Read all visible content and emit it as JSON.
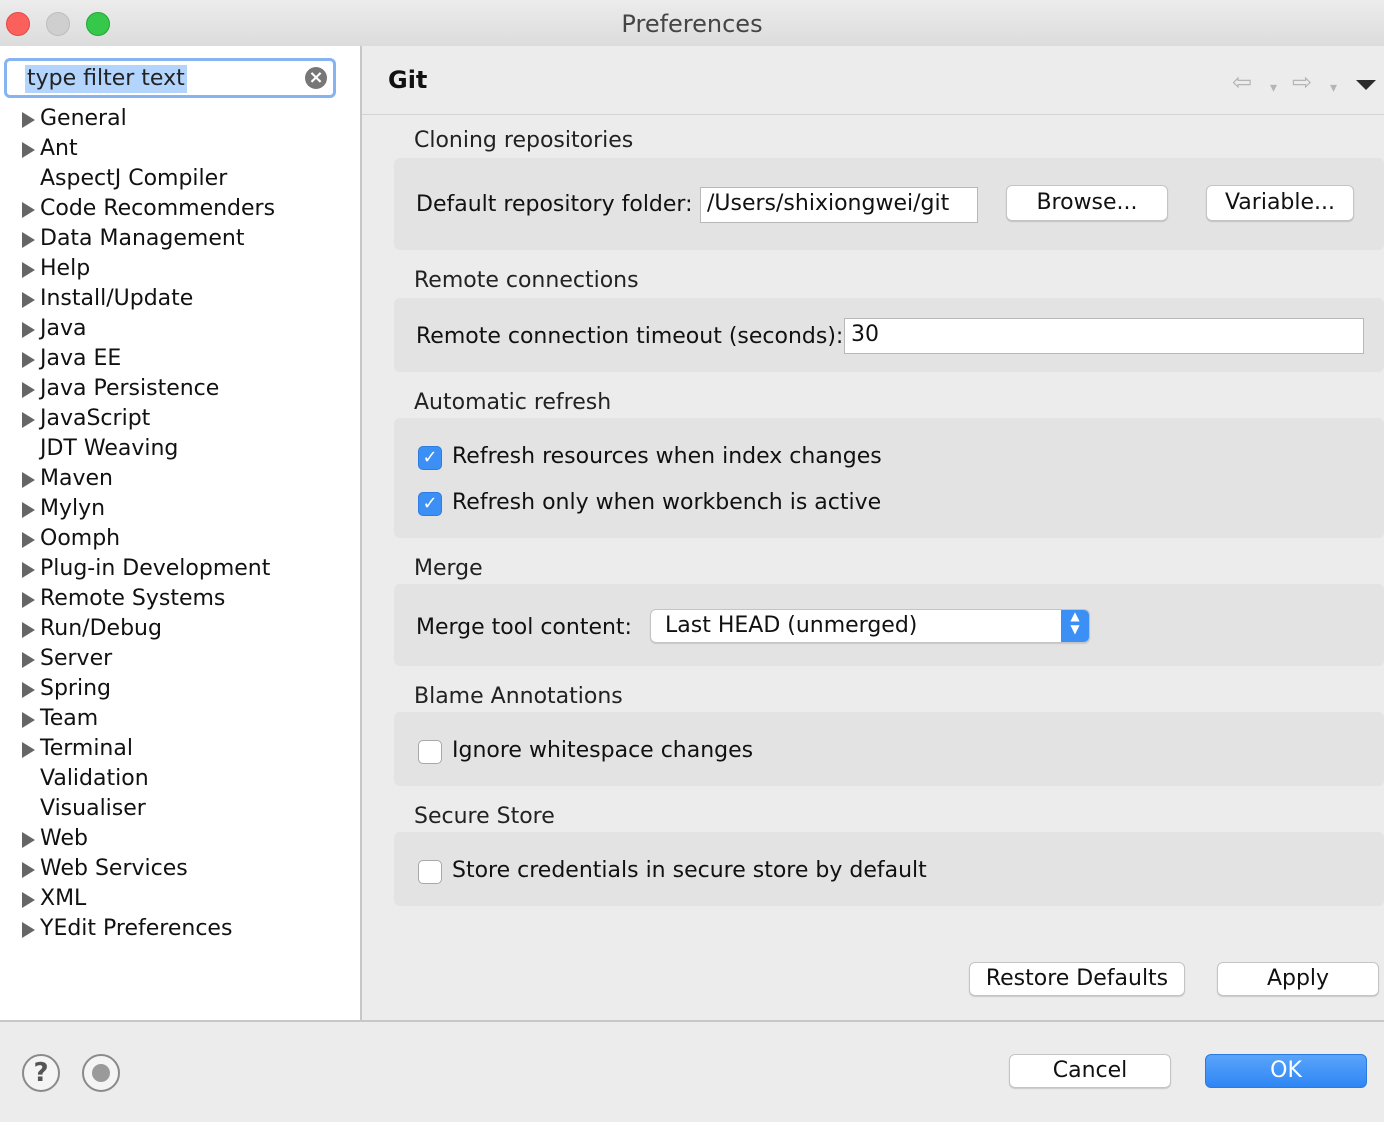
{
  "window": {
    "title": "Preferences"
  },
  "filter": {
    "text": "type filter text"
  },
  "tree": [
    {
      "label": "General",
      "expandable": true
    },
    {
      "label": "Ant",
      "expandable": true
    },
    {
      "label": "AspectJ Compiler",
      "expandable": false
    },
    {
      "label": "Code Recommenders",
      "expandable": true
    },
    {
      "label": "Data Management",
      "expandable": true
    },
    {
      "label": "Help",
      "expandable": true
    },
    {
      "label": "Install/Update",
      "expandable": true
    },
    {
      "label": "Java",
      "expandable": true
    },
    {
      "label": "Java EE",
      "expandable": true
    },
    {
      "label": "Java Persistence",
      "expandable": true
    },
    {
      "label": "JavaScript",
      "expandable": true
    },
    {
      "label": "JDT Weaving",
      "expandable": false
    },
    {
      "label": "Maven",
      "expandable": true
    },
    {
      "label": "Mylyn",
      "expandable": true
    },
    {
      "label": "Oomph",
      "expandable": true
    },
    {
      "label": "Plug-in Development",
      "expandable": true
    },
    {
      "label": "Remote Systems",
      "expandable": true
    },
    {
      "label": "Run/Debug",
      "expandable": true
    },
    {
      "label": "Server",
      "expandable": true
    },
    {
      "label": "Spring",
      "expandable": true
    },
    {
      "label": "Team",
      "expandable": true
    },
    {
      "label": "Terminal",
      "expandable": true
    },
    {
      "label": "Validation",
      "expandable": false
    },
    {
      "label": "Visualiser",
      "expandable": false
    },
    {
      "label": "Web",
      "expandable": true
    },
    {
      "label": "Web Services",
      "expandable": true
    },
    {
      "label": "XML",
      "expandable": true
    },
    {
      "label": "YEdit Preferences",
      "expandable": true
    }
  ],
  "page": {
    "title": "Git",
    "nav": {
      "back_icon": "back-arrow-icon",
      "forward_icon": "forward-arrow-icon",
      "menu_icon": "view-menu-icon"
    },
    "cloning": {
      "heading": "Cloning repositories",
      "folder_label": "Default repository folder:",
      "folder_value": "/Users/shixiongwei/git",
      "browse_label": "Browse...",
      "variable_label": "Variable..."
    },
    "remote": {
      "heading": "Remote connections",
      "timeout_label": "Remote connection timeout (seconds):",
      "timeout_value": "30"
    },
    "refresh": {
      "heading": "Automatic refresh",
      "option1_label": "Refresh resources when index changes",
      "option1_checked": true,
      "option2_label": "Refresh only when workbench is active",
      "option2_checked": true
    },
    "merge": {
      "heading": "Merge",
      "tool_label": "Merge tool content:",
      "tool_value": "Last HEAD (unmerged)"
    },
    "blame": {
      "heading": "Blame Annotations",
      "option_label": "Ignore whitespace changes",
      "option_checked": false
    },
    "secure": {
      "heading": "Secure Store",
      "option_label": "Store credentials in secure store by default",
      "option_checked": false
    },
    "restore_label": "Restore Defaults",
    "apply_label": "Apply"
  },
  "footer": {
    "cancel_label": "Cancel",
    "ok_label": "OK",
    "help_icon": "help-icon",
    "import_icon": "import-export-icon"
  },
  "colors": {
    "accent": "#3b8ff5",
    "selection": "#b3d4fc",
    "focus_ring": "#86b4f0"
  }
}
